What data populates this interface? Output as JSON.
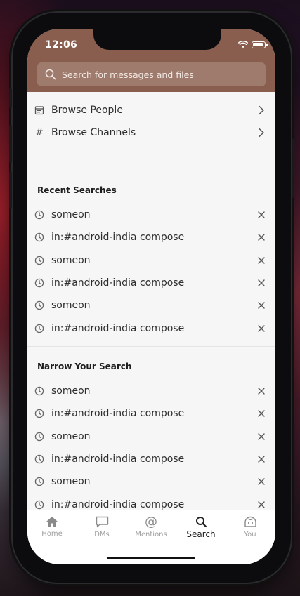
{
  "status_bar": {
    "time": "12:06",
    "signal": "....."
  },
  "search": {
    "placeholder": "Search for messages and files"
  },
  "browse": [
    {
      "label": "Browse People",
      "icon": "calendar-icon"
    },
    {
      "label": "Browse Channels",
      "icon": "hash-icon"
    }
  ],
  "recent": {
    "title": "Recent Searches",
    "items": [
      {
        "label": "someon"
      },
      {
        "label": "in:#android-india compose"
      },
      {
        "label": "someon"
      },
      {
        "label": "in:#android-india compose"
      },
      {
        "label": "someon"
      },
      {
        "label": "in:#android-india compose"
      }
    ]
  },
  "narrow": {
    "title": "Narrow Your Search",
    "items": [
      {
        "label": "someon"
      },
      {
        "label": "in:#android-india compose"
      },
      {
        "label": "someon"
      },
      {
        "label": "in:#android-india compose"
      },
      {
        "label": "someon"
      },
      {
        "label": "in:#android-india compose"
      }
    ]
  },
  "tabs": [
    {
      "label": "Home",
      "icon": "home-icon",
      "active": false
    },
    {
      "label": "DMs",
      "icon": "chat-bubble-icon",
      "active": false
    },
    {
      "label": "Mentions",
      "icon": "at-icon",
      "active": false
    },
    {
      "label": "Search",
      "icon": "search-icon",
      "active": true
    },
    {
      "label": "You",
      "icon": "profile-icon",
      "active": false
    }
  ],
  "colors": {
    "header": "#8a5e4e",
    "screen_background": "#f6f6f6",
    "tab_inactive": "#a0a0a0",
    "tab_active": "#222222"
  }
}
